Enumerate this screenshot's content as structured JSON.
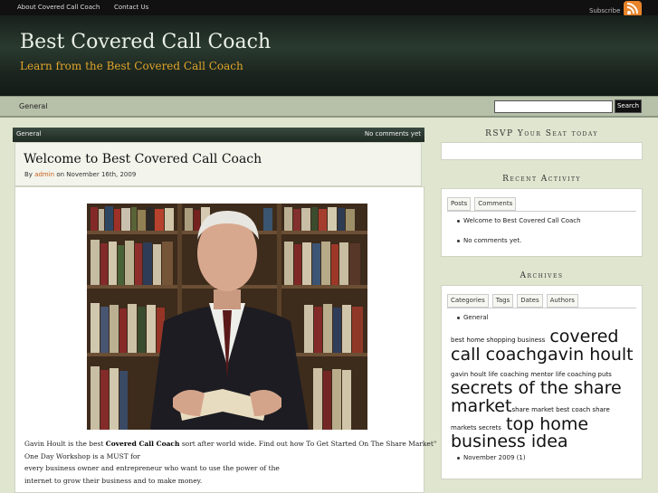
{
  "topbar": {
    "links": [
      "About Covered Call Coach",
      "Contact Us"
    ],
    "subscribe_label": "Subscribe"
  },
  "header": {
    "title": "Best Covered Call Coach",
    "tagline": "Learn from the Best Covered Call Coach"
  },
  "nav": {
    "items": [
      "General"
    ],
    "search": {
      "value": "",
      "button_label": "Search"
    }
  },
  "post": {
    "category": "General",
    "comments": "No comments yet",
    "title": "Welcome to Best Covered Call Coach",
    "meta": {
      "by": "By",
      "author": "admin",
      "date": "on November 16th, 2009"
    },
    "video_icon": "video-thumbnail-man-reading-book",
    "body": {
      "line1_pre": "Gavin Hoult is the best ",
      "line1_bold": "Covered Call Coach",
      "line1_post": " sort after world wide.  Find out how To Get Started On The Share Market\"",
      "line2": "One Day Workshop is a MUST for",
      "line3": "every business owner and entrepreneur who want to use the power of the",
      "line4": "internet to grow their business and to make money."
    }
  },
  "sidebar": {
    "rsvp": {
      "heading": "RSVP Your Seat today"
    },
    "recent": {
      "heading": "Recent Activity",
      "tabs": [
        "Posts",
        "Comments"
      ],
      "items": [
        "Welcome to Best Covered Call Coach",
        "No comments yet."
      ]
    },
    "archives": {
      "heading": "Archives",
      "tabs": [
        "Categories",
        "Tags",
        "Dates",
        "Authors"
      ],
      "category": "General",
      "tags": {
        "t1": "best home shopping business",
        "t2": "covered call coach",
        "t3": "gavin hoult",
        "t4": "gavin hoult life coaching mentor life coaching puts",
        "t5": "secrets of the share market",
        "t6": "share market best coach share markets secrets",
        "t7": "top home business idea"
      },
      "date_item": "November 2009 (1)"
    }
  },
  "colors": {
    "tagline": "#e0a52a",
    "author_link": "#c8641e",
    "rss": "#e8842a"
  }
}
